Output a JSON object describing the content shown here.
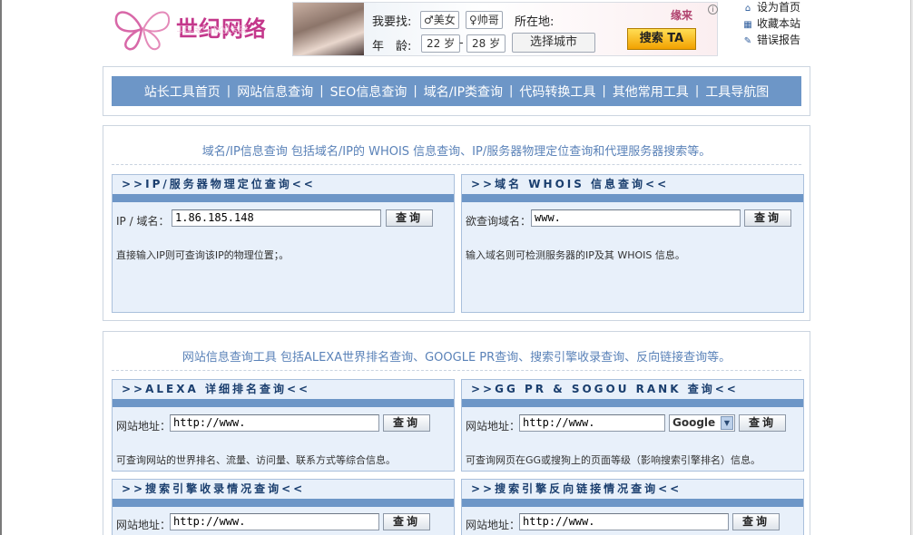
{
  "logo": {
    "text": "世纪网络",
    "reflection": "世纪网络"
  },
  "ad": {
    "find_label": "我要找:",
    "option_female": "♂美女",
    "option_male": "♀帅哥",
    "location_label": "所在地:",
    "age_label": "年　龄:",
    "age_from": "22 岁",
    "age_dash": "-",
    "age_to": "28 岁",
    "city_button": "选择城市",
    "brand": "缘来",
    "search_button": "搜索 TA",
    "info": "i"
  },
  "top_links": [
    {
      "icon": "home-icon",
      "glyph": "⌂",
      "label": "设为首页"
    },
    {
      "icon": "sitemap-icon",
      "glyph": "▦",
      "label": "收藏本站"
    },
    {
      "icon": "edit-icon",
      "glyph": "✎",
      "label": "错误报告"
    }
  ],
  "nav": {
    "items": [
      "站长工具首页",
      "网站信息查询",
      "SEO信息查询",
      "域名/IP类查询",
      "代码转换工具",
      "其他常用工具",
      "工具导航图"
    ],
    "separator": "|"
  },
  "section_domain": {
    "intro": "域名/IP信息查询 包括域名/IP的 WHOIS 信息查询、IP/服务器物理定位查询和代理服务器搜索等。",
    "ip_panel": {
      "title": ">>IP/服务器物理定位查询<<",
      "label": "IP / 域名：",
      "value": "1.86.185.148",
      "button": "查询",
      "desc": "直接输入IP则可查询该IP的物理位置；。"
    },
    "whois_panel": {
      "title": ">>域名 WHOIS 信息查询<<",
      "label": "欲查询域名：",
      "value": "www.",
      "button": "查询",
      "desc": "输入域名则可检测服务器的IP及其 WHOIS 信息。"
    }
  },
  "section_site": {
    "intro": "网站信息查询工具 包括ALEXA世界排名查询、GOOGLE PR查询、搜索引擎收录查询、反向链接查询等。",
    "alexa_panel": {
      "title": ">>ALEXA 详细排名查询<<",
      "label": "网站地址：",
      "value": "http://www.",
      "button": "查询",
      "desc": "可查询网站的世界排名、流量、访问量、联系方式等综合信息。"
    },
    "pr_panel": {
      "title": ">>GG PR & SOGOU RANK 查询<<",
      "label": "网站地址：",
      "value": "http://www.",
      "select": "Google",
      "button": "查询",
      "desc": "可查询网页在GG或搜狗上的页面等级（影响搜索引擎排名）信息。"
    },
    "index_panel": {
      "title": ">>搜索引擎收录情况查询<<",
      "label": "网站地址：",
      "value": "http://www.",
      "button": "查询"
    },
    "backlink_panel": {
      "title": ">>搜索引擎反向链接情况查询<<",
      "label": "网站地址：",
      "value": "http://www.",
      "button": "查询"
    }
  }
}
